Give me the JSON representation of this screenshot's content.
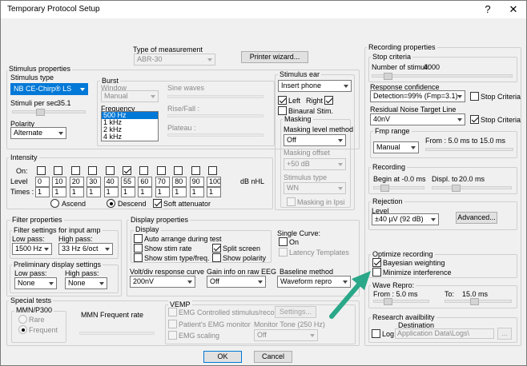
{
  "window": {
    "title": "Temporary Protocol Setup",
    "help_glyph": "?",
    "close_glyph": "✕"
  },
  "measurement": {
    "label": "Type of measurement",
    "value": "ABR-30",
    "printer_button": "Printer wizard..."
  },
  "stimulus": {
    "group_label": "Stimulus properties",
    "type_label": "Stimulus type",
    "type_value": "NB CE-Chirp® LS",
    "rate_label": "Stimuli per sec.",
    "rate_value": "35.1",
    "polarity_label": "Polarity",
    "polarity_value": "Alternate",
    "burst_label": "Burst",
    "window_label": "Window",
    "window_value": "Manual",
    "sine_label": "Sine waves",
    "rise_label": "Rise/Fall :",
    "plateau_label": "Plateau :",
    "frequency_label": "Frequency",
    "frequencies": [
      "500 Hz",
      "1 kHz",
      "2 kHz",
      "4 kHz"
    ],
    "frequency_selected": "500 Hz"
  },
  "ear": {
    "group_label": "Stimulus ear",
    "transducer": "Insert phone",
    "left_label": "Left",
    "left_checked": true,
    "right_label": "Right",
    "right_checked": true,
    "binaural_label": "Binaural Stim.",
    "binaural_checked": false,
    "masking_label": "Masking",
    "masking_method_label": "Masking level method",
    "masking_method_value": "Off",
    "offset_label": "Masking offset",
    "offset_value": "+50 dB",
    "stim_type_label": "Stimulus type",
    "stim_type_value": "WN",
    "ipsi_label": "Masking in Ipsi"
  },
  "intensity": {
    "group_label": "Intensity",
    "on_label": "On:",
    "level_label": "Level",
    "times_label": "Times :",
    "unit": "dB nHL",
    "levels": [
      "0",
      "10",
      "20",
      "30",
      "40",
      "55",
      "60",
      "70",
      "80",
      "90",
      "100"
    ],
    "on": [
      false,
      false,
      false,
      false,
      false,
      true,
      false,
      false,
      false,
      false,
      false
    ],
    "times": [
      "1",
      "1",
      "1",
      "1",
      "1",
      "1",
      "1",
      "1",
      "1",
      "1",
      "1"
    ],
    "ascend_label": "Ascend",
    "descend_label": "Descend",
    "order_selected": "Descend",
    "soft_label": "Soft attenuator",
    "soft_checked": true
  },
  "filter": {
    "group_label": "Filter properties",
    "mmn_label": "Filter settings for input amp",
    "lowpass_label": "Low pass:",
    "lowpass_value": "1500 Hz",
    "highpass_label": "High pass:",
    "highpass_value": "33 Hz 6/oct",
    "prelim_label": "Preliminary display settings",
    "pre_low_label": "Low pass:",
    "pre_low_value": "None",
    "pre_high_label": "High pass:",
    "pre_high_value": "None"
  },
  "display": {
    "group_label": "Display properties",
    "sub_label": "Display",
    "items": [
      {
        "label": "Auto arrange during test",
        "checked": false
      },
      {
        "label": "Show stim rate",
        "checked": false
      },
      {
        "label": "Show stim type/freq.",
        "checked": false
      },
      {
        "label": "Split screen",
        "checked": true
      },
      {
        "label": "Show polarity",
        "checked": false
      }
    ],
    "single_label": "Single Curve:",
    "on_label": "On",
    "latency_label": "Latency Templates",
    "voltdiv_label": "Volt/div response curve",
    "voltdiv_value": "200nV",
    "gain_label": "Gain info on raw EEG",
    "gain_value": "Off",
    "baseline_label": "Baseline method",
    "baseline_value": "Waveform repro"
  },
  "special": {
    "group_label": "Special tests",
    "mmn_label": "MMN/P300",
    "rare_label": "Rare",
    "frequent_label": "Frequent",
    "freq_rate_label": "MMN Frequent rate",
    "vemp_label": "VEMP",
    "emg_label": "EMG Controlled stimulus/recording",
    "settings_button": "Settings...",
    "patient_label": "Patient's EMG monitor",
    "monitor_label": "Monitor Tone (250 Hz)",
    "monitor_value": "Off",
    "scaling_label": "EMG scaling"
  },
  "recording": {
    "group_label": "Recording properties",
    "stop_label": "Stop criteria",
    "num_stimuli_label": "Number of stimuli:",
    "num_stimuli_value": "4000",
    "response_label": "Response confidence",
    "response_value": "Detection=99% (Fmp=3.1)",
    "stop_criteria_label": "Stop Criteria",
    "response_stop_checked": false,
    "noise_label": "Residual Noise Target Line",
    "noise_value": "40nV",
    "noise_stop_checked": true,
    "fmp_label": "Fmp range",
    "fmp_value": "Manual",
    "fmp_from": "From : 5.0 ms to 15.0 ms",
    "rec_label": "Recording",
    "begin_label": "Begin at -0.0 ms",
    "displ_label": "Displ. to",
    "displ_value": "20.0 ms",
    "rejection_label": "Rejection",
    "level_label": "Level",
    "level_value": "±40 µV (92 dB)",
    "advanced_button": "Advanced...",
    "optimize_label": "Optimize recording",
    "bayesian_label": "Bayesian weighting",
    "bayesian_checked": true,
    "minimize_label": "Minimize interference",
    "minimize_checked": false,
    "wave_label": "Wave Repro:",
    "wave_from": "From :  5.0 ms",
    "wave_to_label": "To:",
    "wave_to": "15.0 ms",
    "research_label": "Research availbility",
    "destination_label": "Destination",
    "log_label": "Log",
    "log_checked": false,
    "dest_value": "Application Data\\Logs\\",
    "browse_label": "..."
  },
  "footer": {
    "ok": "OK",
    "cancel": "Cancel"
  },
  "annotation": {
    "arrow_color": "#2aa889"
  }
}
